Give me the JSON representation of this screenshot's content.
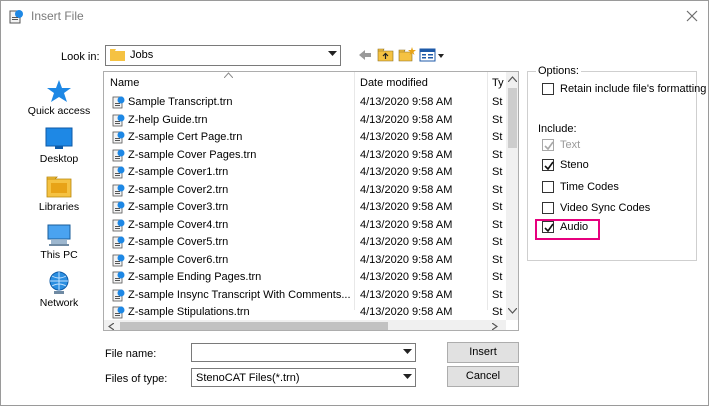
{
  "window": {
    "title": "Insert File"
  },
  "look_in": {
    "label": "Look in:",
    "value": "Jobs"
  },
  "places": [
    {
      "label": "Quick access",
      "icon": "star-icon"
    },
    {
      "label": "Desktop",
      "icon": "desktop-icon"
    },
    {
      "label": "Libraries",
      "icon": "libraries-icon"
    },
    {
      "label": "This PC",
      "icon": "computer-icon"
    },
    {
      "label": "Network",
      "icon": "network-icon"
    }
  ],
  "file_list": {
    "columns": {
      "name": "Name",
      "date": "Date modified",
      "type": "Ty"
    },
    "files": [
      {
        "name": "Sample Transcript.trn",
        "date": "4/13/2020 9:58 AM",
        "type": "St"
      },
      {
        "name": "Z-help Guide.trn",
        "date": "4/13/2020 9:58 AM",
        "type": "St"
      },
      {
        "name": "Z-sample Cert Page.trn",
        "date": "4/13/2020 9:58 AM",
        "type": "St"
      },
      {
        "name": "Z-sample Cover Pages.trn",
        "date": "4/13/2020 9:58 AM",
        "type": "St"
      },
      {
        "name": "Z-sample Cover1.trn",
        "date": "4/13/2020 9:58 AM",
        "type": "St"
      },
      {
        "name": "Z-sample Cover2.trn",
        "date": "4/13/2020 9:58 AM",
        "type": "St"
      },
      {
        "name": "Z-sample Cover3.trn",
        "date": "4/13/2020 9:58 AM",
        "type": "St"
      },
      {
        "name": "Z-sample Cover4.trn",
        "date": "4/13/2020 9:58 AM",
        "type": "St"
      },
      {
        "name": "Z-sample Cover5.trn",
        "date": "4/13/2020 9:58 AM",
        "type": "St"
      },
      {
        "name": "Z-sample Cover6.trn",
        "date": "4/13/2020 9:58 AM",
        "type": "St"
      },
      {
        "name": "Z-sample Ending Pages.trn",
        "date": "4/13/2020 9:58 AM",
        "type": "St"
      },
      {
        "name": "Z-sample Insync Transcript With Comments...",
        "date": "4/13/2020 9:58 AM",
        "type": "St"
      },
      {
        "name": "Z-sample Stipulations.trn",
        "date": "4/13/2020 9:58 AM",
        "type": "St"
      }
    ]
  },
  "options": {
    "legend": "Options:",
    "retain_formatting": {
      "label": "Retain include file's formatting",
      "checked": false
    },
    "include_label": "Include:",
    "include": [
      {
        "label": "Text",
        "checked": true,
        "disabled": true
      },
      {
        "label": "Steno",
        "checked": true,
        "disabled": false
      },
      {
        "label": "Time Codes",
        "checked": false,
        "disabled": false
      },
      {
        "label": "Video Sync Codes",
        "checked": false,
        "disabled": false
      },
      {
        "label": "Audio",
        "checked": true,
        "disabled": false
      }
    ]
  },
  "file_name": {
    "label": "File name:",
    "value": ""
  },
  "file_type": {
    "label": "Files of type:",
    "value": "StenoCAT Files(*.trn)"
  },
  "buttons": {
    "insert": "Insert",
    "cancel": "Cancel"
  },
  "colors": {
    "highlight": "#e6007e",
    "accent_blue": "#1e88e5",
    "folder_yellow": "#f5c242"
  }
}
